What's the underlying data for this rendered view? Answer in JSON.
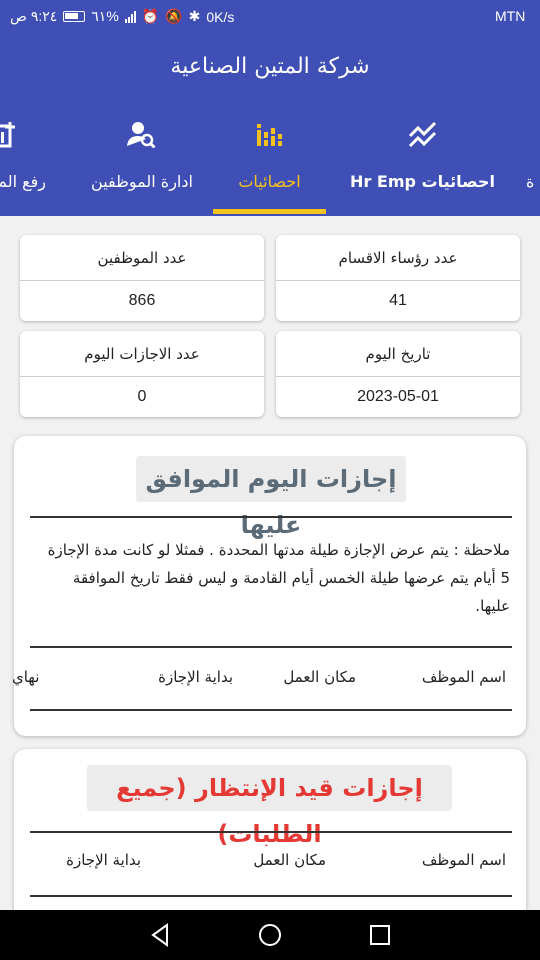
{
  "status_bar": {
    "time": "٩:٢٤ ص",
    "battery": "٦١%",
    "net_speed": "0K/s",
    "carrier": "MTN"
  },
  "app_bar": {
    "title": "شركة المتين الصناعية"
  },
  "tabs": [
    {
      "label": "رفع الم",
      "icon": "upload-chart-icon",
      "active": false
    },
    {
      "label": "ادارة الموظفين",
      "icon": "manage-users-icon",
      "active": false
    },
    {
      "label": "احصائيات",
      "icon": "bar-chart-icon",
      "active": true
    },
    {
      "label": "احصائيات Hr Emp",
      "icon": "trend-lines-icon",
      "active": false
    },
    {
      "label": "ة",
      "icon": "",
      "active": false
    }
  ],
  "stats": {
    "department_heads": {
      "label": "عدد رؤساء الاقسام",
      "value": "41"
    },
    "employees": {
      "label": "عدد الموظفين",
      "value": "866"
    },
    "today_date": {
      "label": "تاريخ اليوم",
      "value": "2023-05-01"
    },
    "today_leaves": {
      "label": "عدد الاجازات اليوم",
      "value": "0"
    }
  },
  "approved_today": {
    "title": "إجازات اليوم الموافق عليها",
    "title_color": "#5b6b78",
    "note": "ملاحظة : يتم عرض الإجازة طيلة مدتها المحددة . فمثلا لو كانت مدة الإجازة 5 أيام يتم عرضها طيلة الخمس أيام القادمة و ليس فقط تاريخ الموافقة عليها.",
    "columns": [
      "اسم الموظف",
      "مكان العمل",
      "بداية الإجازة",
      "نهاي"
    ]
  },
  "pending": {
    "title": "إجازات قيد الإنتظار (جميع الطلبات)",
    "title_color": "#e53935",
    "columns": [
      "اسم الموظف",
      "مكان العمل",
      "بداية الإجازة"
    ]
  },
  "colors": {
    "primary": "#3f4fb6",
    "accent": "#f7c21d"
  },
  "nav_bar": [
    "back-icon",
    "home-icon",
    "recents-icon"
  ]
}
